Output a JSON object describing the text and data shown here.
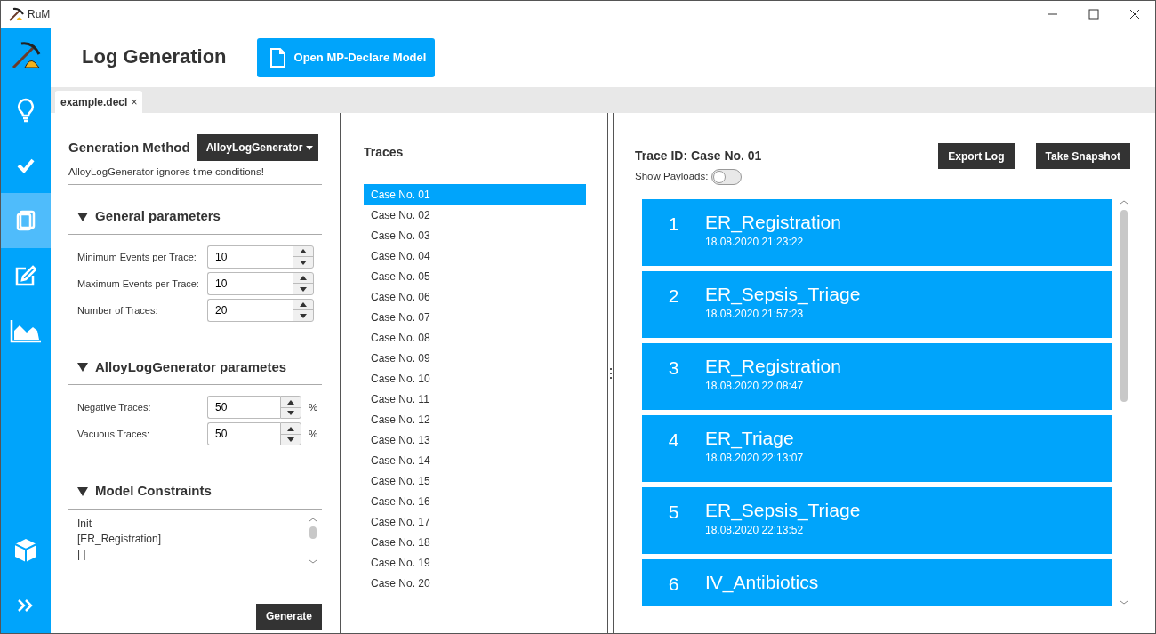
{
  "window": {
    "title": "RuM"
  },
  "sidebar": {
    "items": [
      {
        "selected": false
      },
      {
        "selected": false
      },
      {
        "selected": true
      },
      {
        "selected": false
      },
      {
        "selected": false
      }
    ],
    "bottom_items": [
      {
        "selected": false
      },
      {
        "selected": false
      }
    ]
  },
  "header": {
    "title": "Log Generation",
    "open_button": "Open MP-Declare Model"
  },
  "tabs": [
    {
      "label": "example.decl",
      "close": "×",
      "selected": true
    }
  ],
  "generation": {
    "label": "Generation Method",
    "method": "AlloyLogGenerator",
    "warning": "AlloyLogGenerator ignores time conditions!",
    "sections": [
      {
        "title": "General parameters",
        "expanded": true,
        "fields": [
          {
            "label": "Minimum Events per Trace:",
            "value": "10"
          },
          {
            "label": "Maximum Events per Trace:",
            "value": "10"
          },
          {
            "label": "Number of Traces:",
            "value": "20"
          }
        ]
      },
      {
        "title": "AlloyLogGenerator parametes",
        "expanded": true,
        "fields": [
          {
            "label": "Negative Traces:",
            "value": "50",
            "unit": "%"
          },
          {
            "label": "Vacuous Traces:",
            "value": "50",
            "unit": "%"
          }
        ]
      }
    ],
    "constraints": {
      "title": "Model Constraints",
      "expanded": true,
      "lines": [
        "Init",
        "[ER_Registration]",
        "| |"
      ]
    },
    "generate_button": "Generate"
  },
  "traces": {
    "title": "Traces",
    "items": [
      {
        "label": "Case No. 01",
        "selected": true
      },
      {
        "label": "Case No. 02",
        "selected": false
      },
      {
        "label": "Case No. 03",
        "selected": false
      },
      {
        "label": "Case No. 04",
        "selected": false
      },
      {
        "label": "Case No. 05",
        "selected": false
      },
      {
        "label": "Case No. 06",
        "selected": false
      },
      {
        "label": "Case No. 07",
        "selected": false
      },
      {
        "label": "Case No. 08",
        "selected": false
      },
      {
        "label": "Case No. 09",
        "selected": false
      },
      {
        "label": "Case No. 10",
        "selected": false
      },
      {
        "label": "Case No. 11",
        "selected": false
      },
      {
        "label": "Case No. 12",
        "selected": false
      },
      {
        "label": "Case No. 13",
        "selected": false
      },
      {
        "label": "Case No. 14",
        "selected": false
      },
      {
        "label": "Case No. 15",
        "selected": false
      },
      {
        "label": "Case No. 16",
        "selected": false
      },
      {
        "label": "Case No. 17",
        "selected": false
      },
      {
        "label": "Case No. 18",
        "selected": false
      },
      {
        "label": "Case No. 19",
        "selected": false
      },
      {
        "label": "Case No. 20",
        "selected": false
      }
    ]
  },
  "trace_view": {
    "title": "Trace ID: Case No. 01",
    "buttons": [
      "Export Log",
      "Take Snapshot"
    ],
    "payloads_label": "Show Payloads:",
    "show_payloads": false,
    "events": [
      {
        "index": "1",
        "name": "ER_Registration",
        "time": "18.08.2020 21:23:22"
      },
      {
        "index": "2",
        "name": "ER_Sepsis_Triage",
        "time": "18.08.2020 21:57:23"
      },
      {
        "index": "3",
        "name": "ER_Registration",
        "time": "18.08.2020 22:08:47"
      },
      {
        "index": "4",
        "name": "ER_Triage",
        "time": "18.08.2020 22:13:07"
      },
      {
        "index": "5",
        "name": "ER_Sepsis_Triage",
        "time": "18.08.2020 22:13:52"
      },
      {
        "index": "6",
        "name": "IV_Antibiotics"
      }
    ]
  }
}
